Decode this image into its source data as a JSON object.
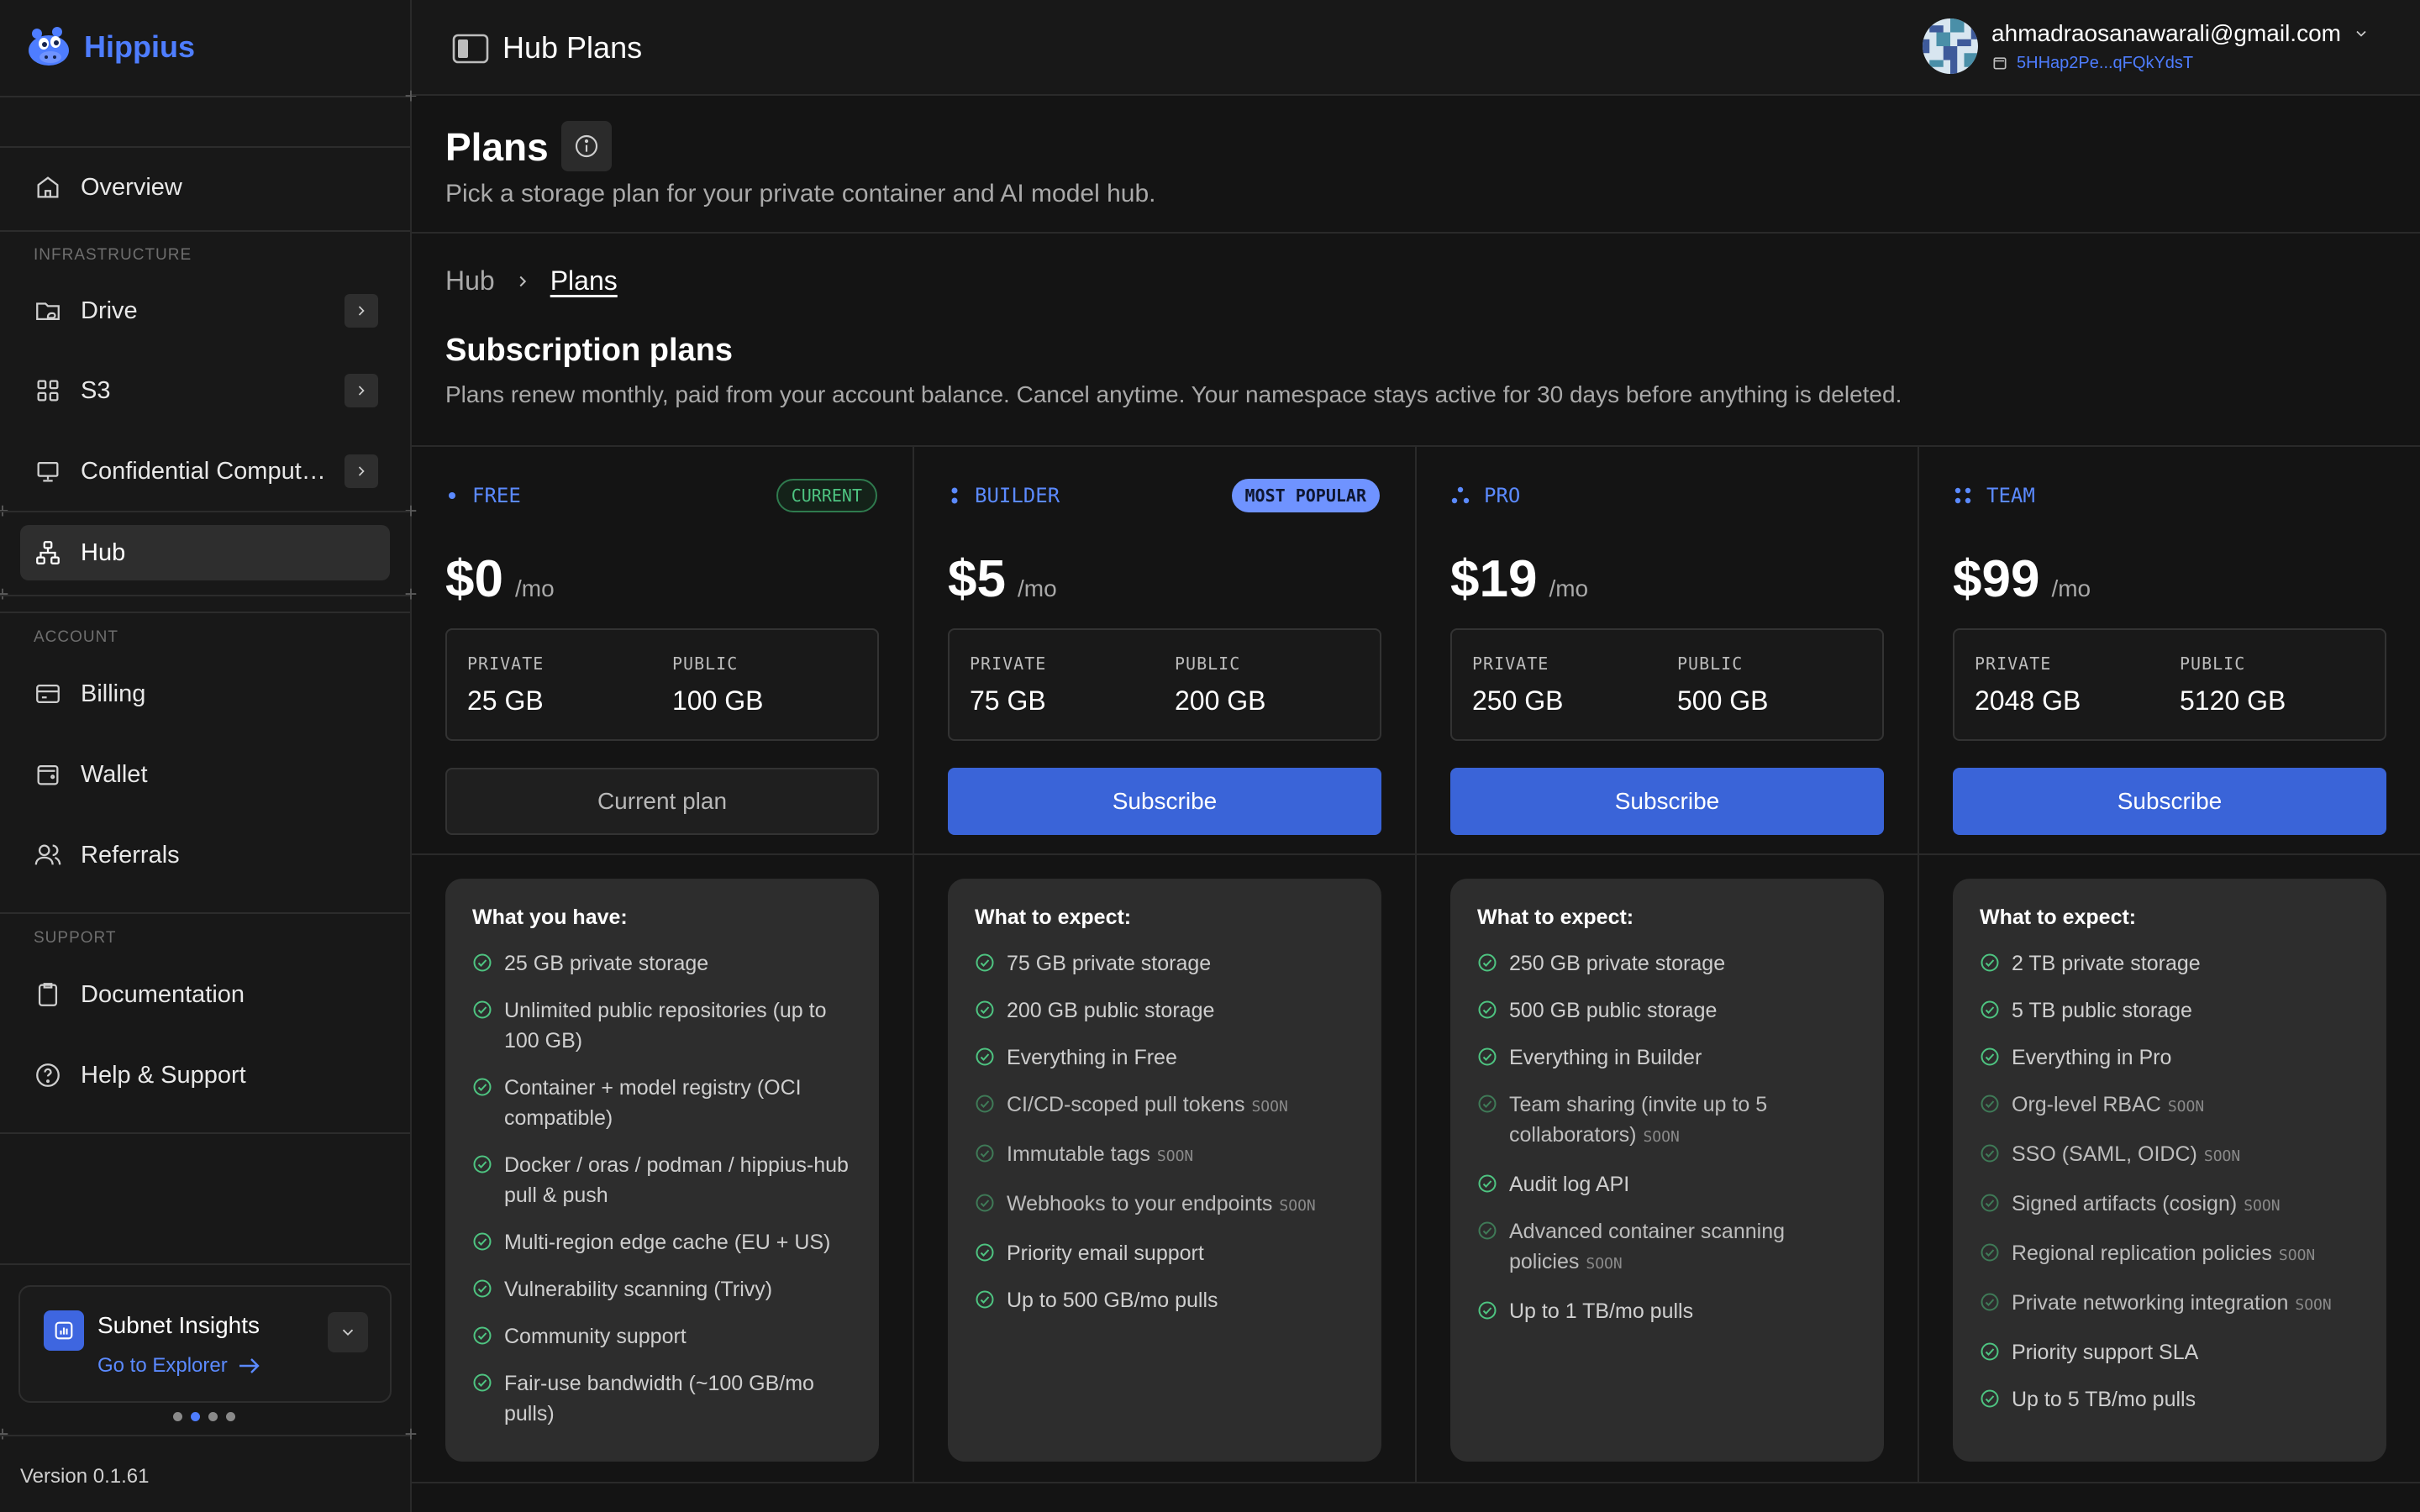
{
  "brand": {
    "name": "Hippius"
  },
  "sidebar": {
    "nav": [
      {
        "label": "Overview",
        "icon": "home-icon"
      }
    ],
    "infrastructure_label": "INFRASTRUCTURE",
    "infrastructure": [
      {
        "label": "Drive",
        "icon": "folder-cloud-icon"
      },
      {
        "label": "S3",
        "icon": "grid-icon"
      },
      {
        "label": "Confidential Computi...",
        "icon": "monitor-icon"
      },
      {
        "label": "Hub",
        "icon": "hub-network-icon",
        "active": true
      }
    ],
    "account_label": "ACCOUNT",
    "account": [
      {
        "label": "Billing",
        "icon": "card-icon"
      },
      {
        "label": "Wallet",
        "icon": "wallet-icon"
      },
      {
        "label": "Referrals",
        "icon": "users-icon"
      }
    ],
    "support_label": "SUPPORT",
    "support": [
      {
        "label": "Documentation",
        "icon": "document-icon"
      },
      {
        "label": "Help & Support",
        "icon": "help-circle-icon"
      }
    ],
    "insights": {
      "title": "Subnet Insights",
      "link": "Go to Explorer"
    },
    "version": "Version 0.1.61"
  },
  "topbar": {
    "title": "Hub Plans",
    "email": "ahmadraosanawarali@gmail.com",
    "address": "5HHap2Pe...qFQkYdsT"
  },
  "page": {
    "title": "Plans",
    "subtitle": "Pick a storage plan for your private container and AI model hub."
  },
  "breadcrumb": {
    "root": "Hub",
    "current": "Plans"
  },
  "subscriptions": {
    "title": "Subscription plans",
    "description": "Plans renew monthly, paid from your account balance. Cancel anytime. Your namespace stays active for 30 days before anything is deleted."
  },
  "plans": [
    {
      "name": "FREE",
      "badge": "CURRENT",
      "price": "$0",
      "period": "/mo",
      "private_label": "PRIVATE",
      "private": "25 GB",
      "public_label": "PUBLIC",
      "public": "100 GB",
      "button": "Current plan",
      "features_title": "What you have:",
      "features": [
        {
          "text": "25 GB private storage"
        },
        {
          "text": "Unlimited public repositories (up to 100 GB)"
        },
        {
          "text": "Container + model registry (OCI compatible)"
        },
        {
          "text": "Docker / oras / podman / hippius-hub pull & push"
        },
        {
          "text": "Multi-region edge cache (EU + US)"
        },
        {
          "text": "Vulnerability scanning (Trivy)"
        },
        {
          "text": "Community support"
        },
        {
          "text": "Fair-use bandwidth (~100 GB/mo pulls)"
        }
      ]
    },
    {
      "name": "BUILDER",
      "badge": "MOST POPULAR",
      "price": "$5",
      "period": "/mo",
      "private_label": "PRIVATE",
      "private": "75 GB",
      "public_label": "PUBLIC",
      "public": "200 GB",
      "button": "Subscribe",
      "features_title": "What to expect:",
      "features": [
        {
          "text": "75 GB private storage"
        },
        {
          "text": "200 GB public storage"
        },
        {
          "text": "Everything in Free"
        },
        {
          "text": "CI/CD-scoped pull tokens",
          "soon": "SOON"
        },
        {
          "text": "Immutable tags",
          "soon": "SOON"
        },
        {
          "text": "Webhooks to your endpoints",
          "soon": "SOON"
        },
        {
          "text": "Priority email support"
        },
        {
          "text": "Up to 500 GB/mo pulls"
        }
      ]
    },
    {
      "name": "PRO",
      "badge": "",
      "price": "$19",
      "period": "/mo",
      "private_label": "PRIVATE",
      "private": "250 GB",
      "public_label": "PUBLIC",
      "public": "500 GB",
      "button": "Subscribe",
      "features_title": "What to expect:",
      "features": [
        {
          "text": "250 GB private storage"
        },
        {
          "text": "500 GB public storage"
        },
        {
          "text": "Everything in Builder"
        },
        {
          "text": "Team sharing (invite up to 5 collaborators)",
          "soon": "SOON"
        },
        {
          "text": "Audit log API"
        },
        {
          "text": "Advanced container scanning policies",
          "soon": "SOON"
        },
        {
          "text": "Up to 1 TB/mo pulls"
        }
      ]
    },
    {
      "name": "TEAM",
      "badge": "",
      "price": "$99",
      "period": "/mo",
      "private_label": "PRIVATE",
      "private": "2048 GB",
      "public_label": "PUBLIC",
      "public": "5120 GB",
      "button": "Subscribe",
      "features_title": "What to expect:",
      "features": [
        {
          "text": "2 TB private storage"
        },
        {
          "text": "5 TB public storage"
        },
        {
          "text": "Everything in Pro"
        },
        {
          "text": "Org-level RBAC",
          "soon": "SOON"
        },
        {
          "text": "SSO (SAML, OIDC)",
          "soon": "SOON"
        },
        {
          "text": "Signed artifacts (cosign)",
          "soon": "SOON"
        },
        {
          "text": "Regional replication policies",
          "soon": "SOON"
        },
        {
          "text": "Private networking integration",
          "soon": "SOON"
        },
        {
          "text": "Priority support SLA"
        },
        {
          "text": "Up to 5 TB/mo pulls"
        }
      ]
    }
  ],
  "colors": {
    "accent": "#3a64d8",
    "brand": "#4e7dff",
    "success": "#4ec481"
  }
}
